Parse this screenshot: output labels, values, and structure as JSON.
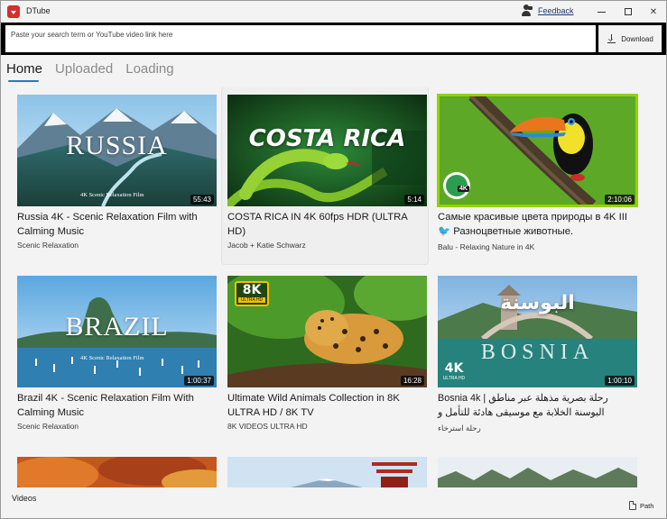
{
  "app": {
    "title": "DTube",
    "feedback_label": "Feedback"
  },
  "search": {
    "placeholder": "Paste your search term or YouTube video link here",
    "download_label": "Download"
  },
  "tabs": [
    {
      "label": "Home",
      "active": true
    },
    {
      "label": "Uploaded",
      "active": false
    },
    {
      "label": "Loading",
      "active": false
    }
  ],
  "videos": [
    {
      "thumb_text": "RUSSIA",
      "thumb_subtext": "4K Scenic Relaxation Film",
      "duration": "55:43",
      "title": "Russia 4K - Scenic Relaxation Film with Calming Music",
      "channel": "Scenic Relaxation"
    },
    {
      "thumb_text": "COSTA RICA",
      "duration": "5:14",
      "title": "COSTA RICA IN 4K 60fps HDR (ULTRA HD)",
      "channel": "Jacob + Katie Schwarz"
    },
    {
      "badge": "4K",
      "duration": "2:10:06",
      "title": "Самые красивые цвета природы в 4K III 🐦 Разноцветные животные.",
      "channel": "Balu - Relaxing Nature in 4K"
    },
    {
      "thumb_text": "BRAZIL",
      "thumb_subtext": "4K Scenic Relaxation Film",
      "duration": "1:00:37",
      "title": "Brazil 4K - Scenic Relaxation Film With Calming Music",
      "channel": "Scenic Relaxation"
    },
    {
      "badge_line1": "8K",
      "badge_line2": "ULTRA HD",
      "duration": "16:28",
      "title": "Ultimate Wild Animals Collection in 8K ULTRA HD / 8K TV",
      "channel": "8K VIDEOS ULTRA HD"
    },
    {
      "thumb_text": "البوسنة",
      "thumb_subtext": "BOSNIA",
      "badge_line1": "4K",
      "badge_line2": "ULTRA HD",
      "duration": "1:00:10",
      "title": "Bosnia 4k | رحلة بصرية مذهلة عبر مناطق البوسنة الخلابة مع موسيقى هادئة للتأمل و",
      "channel": "رحلة استرخاء"
    }
  ],
  "footer": {
    "videos_label": "Videos",
    "path_label": "Path"
  },
  "colors": {
    "accent": "#2b78c5",
    "selected_outline": "#8fd400",
    "titlebar": "#f3f3f3",
    "search_band": "#000000"
  }
}
